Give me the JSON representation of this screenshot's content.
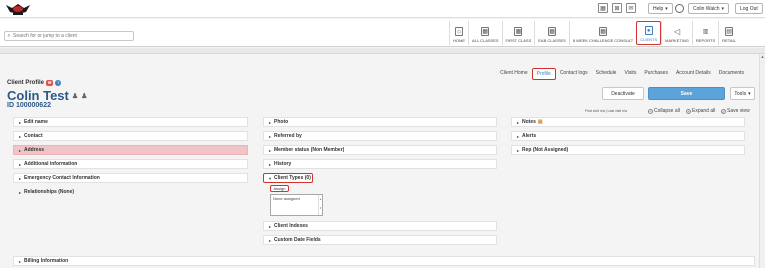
{
  "topbar": {
    "icons": [
      "calendar-icon",
      "grid-icon",
      "mail-icon"
    ],
    "help_label": "Help",
    "user_label": "Colin Walch",
    "logout_label": "Log Out"
  },
  "search": {
    "placeholder": "Search for or jump to a client"
  },
  "nav": {
    "items": [
      {
        "label": "HOME",
        "icon": "home-icon"
      },
      {
        "label": "ALL CLASSES",
        "icon": "calendar-icon"
      },
      {
        "label": "FIRST CLASS",
        "icon": "calendar-icon"
      },
      {
        "label": "EAB CLASSES",
        "icon": "calendar-icon"
      },
      {
        "label": "8 WEEK CHALLENGE CONSULT",
        "icon": "calendar-icon"
      },
      {
        "label": "CLIENTS",
        "icon": "person-icon",
        "active": true
      },
      {
        "label": "MARKETING",
        "icon": "megaphone-icon"
      },
      {
        "label": "REPORTS",
        "icon": "bar-chart-icon"
      },
      {
        "label": "RETAIL",
        "icon": "register-icon"
      }
    ]
  },
  "subtabs": [
    "Client Home",
    "Profile",
    "Contact logs",
    "Schedule",
    "Visits",
    "Purchases",
    "Account Details",
    "Documents"
  ],
  "profile": {
    "label": "Client Profile",
    "name": "Colin Test",
    "id": "ID 100000622"
  },
  "actions": {
    "deactivate": "Deactivate",
    "save": "Save",
    "tools": "Tools"
  },
  "visit_info": "First visit n/a  |  Last visit n/a",
  "controls": {
    "collapse_all": "Collapse all",
    "expand_all": "Expand all",
    "save_view": "Save view"
  },
  "col1": [
    "Edit name",
    "Contact",
    "Address",
    "Additional information",
    "Emergency Contact Information",
    "Relationships (None)"
  ],
  "col2": {
    "before": [
      "Photo",
      "Referred by",
      "Member status (Non Member)",
      "History"
    ],
    "client_types": "Client Types (0)",
    "assign_label": "Assign",
    "types_value": "None assigned",
    "after": [
      "Client Indexes",
      "Custom Date Fields"
    ]
  },
  "col3": [
    "Notes",
    "Alerts",
    "Rep (Not Assigned)"
  ],
  "billing": "Billing Information"
}
